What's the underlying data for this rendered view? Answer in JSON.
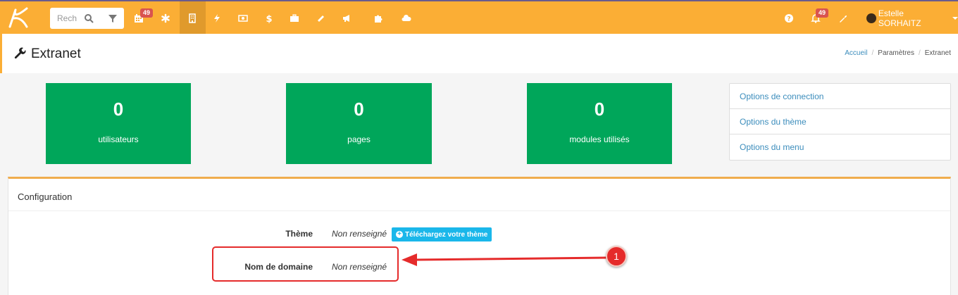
{
  "topbar": {
    "search_placeholder": "Recherche",
    "calendar_badge": "49",
    "notif_badge": "49",
    "user_name": "Estelle SORHAITZ",
    "icons": [
      "search-icon",
      "filter-icon",
      "calendar-icon",
      "asterisk-icon",
      "building-icon",
      "bolt-icon",
      "money-icon",
      "dollar-icon",
      "briefcase-icon",
      "ticket-icon",
      "bullhorn-icon",
      "puzzle-icon",
      "cloud-icon",
      "help-icon",
      "bell-icon",
      "wrench-icon"
    ]
  },
  "header": {
    "title": "Extranet",
    "breadcrumb": [
      "Accueil",
      "Paramètres",
      "Extranet"
    ]
  },
  "stats": [
    {
      "value": "0",
      "label": "utilisateurs"
    },
    {
      "value": "0",
      "label": "pages"
    },
    {
      "value": "0",
      "label": "modules utilisés"
    }
  ],
  "options": [
    "Options de connection",
    "Options du thème",
    "Options du menu"
  ],
  "config": {
    "title": "Configuration",
    "rows": [
      {
        "label": "Thème",
        "value": "Non renseigné",
        "button": "Téléchargez votre thème"
      },
      {
        "label": "Nom de domaine",
        "value": "Non renseigné"
      }
    ]
  },
  "annotation": {
    "number": "1",
    "color": "#e52b2b"
  },
  "colors": {
    "topbar": "#fbae35",
    "stat": "#00a65a",
    "link": "#3c8dbc",
    "button": "#1ab7ea"
  }
}
